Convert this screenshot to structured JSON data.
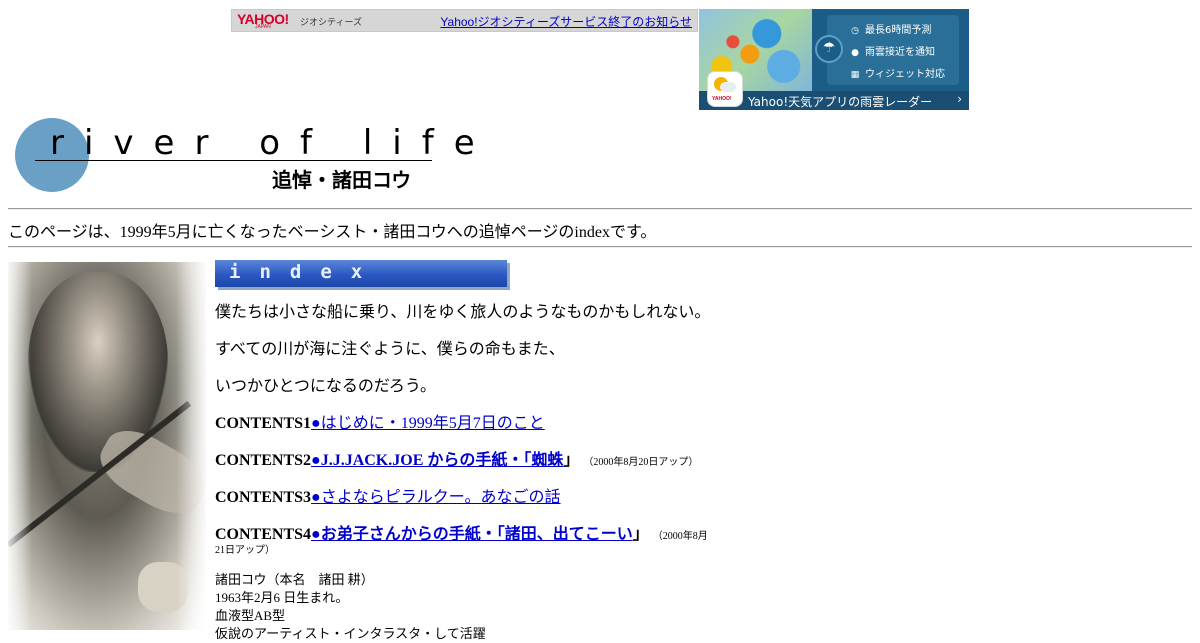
{
  "geocities": {
    "logo": "YAHOO!",
    "logo_sub": "JAPAN",
    "service": "ジオシティーズ",
    "notice_link": "Yahoo!ジオシティーズサービス終了のお知らせ"
  },
  "ad": {
    "features": [
      "最長6時間予測",
      "雨雲接近を通知",
      "ウィジェット対応"
    ],
    "app_label": "YAHOO!",
    "cta": "Yahoo!天気アプリの雨雲レーダー",
    "cta_arrow": "›"
  },
  "title": {
    "main": "river of life",
    "sub": "追悼・諸田コウ"
  },
  "intro": "このページは、1999年5月に亡くなったベーシスト・諸田コウへの追悼ページのindexです。",
  "index_banner": "index",
  "poem": [
    "僕たちは小さな船に乗り、川をゆく旅人のようなものかもしれない。",
    "すべての川が海に注ぐように、僕らの命もまた、",
    "いつかひとつになるのだろう。"
  ],
  "contents": [
    {
      "label": "CONTENTS1",
      "link": "●はじめに・1999年5月7日のこと",
      "suffix": "",
      "note": ""
    },
    {
      "label": "CONTENTS2",
      "link": "●J.J.JACK.JOE からの手紙・「蜘蛛",
      "suffix": "」",
      "note": "（2000年8月20日アップ）"
    },
    {
      "label": "CONTENTS3",
      "link": "●さよならピラルクー。あなごの話",
      "suffix": "",
      "note": ""
    },
    {
      "label": "CONTENTS4",
      "link": "●お弟子さんからの手紙・「諸田、出てこーい",
      "suffix": "」",
      "note": "（2000年8月",
      "note2": "21日アップ）"
    }
  ],
  "profile": [
    "諸田コウ（本名　諸田 耕）",
    "1963年2月6 日生まれ。",
    "血液型AB型",
    "仮說のアーティスト・インタラスタ・して活躍"
  ]
}
